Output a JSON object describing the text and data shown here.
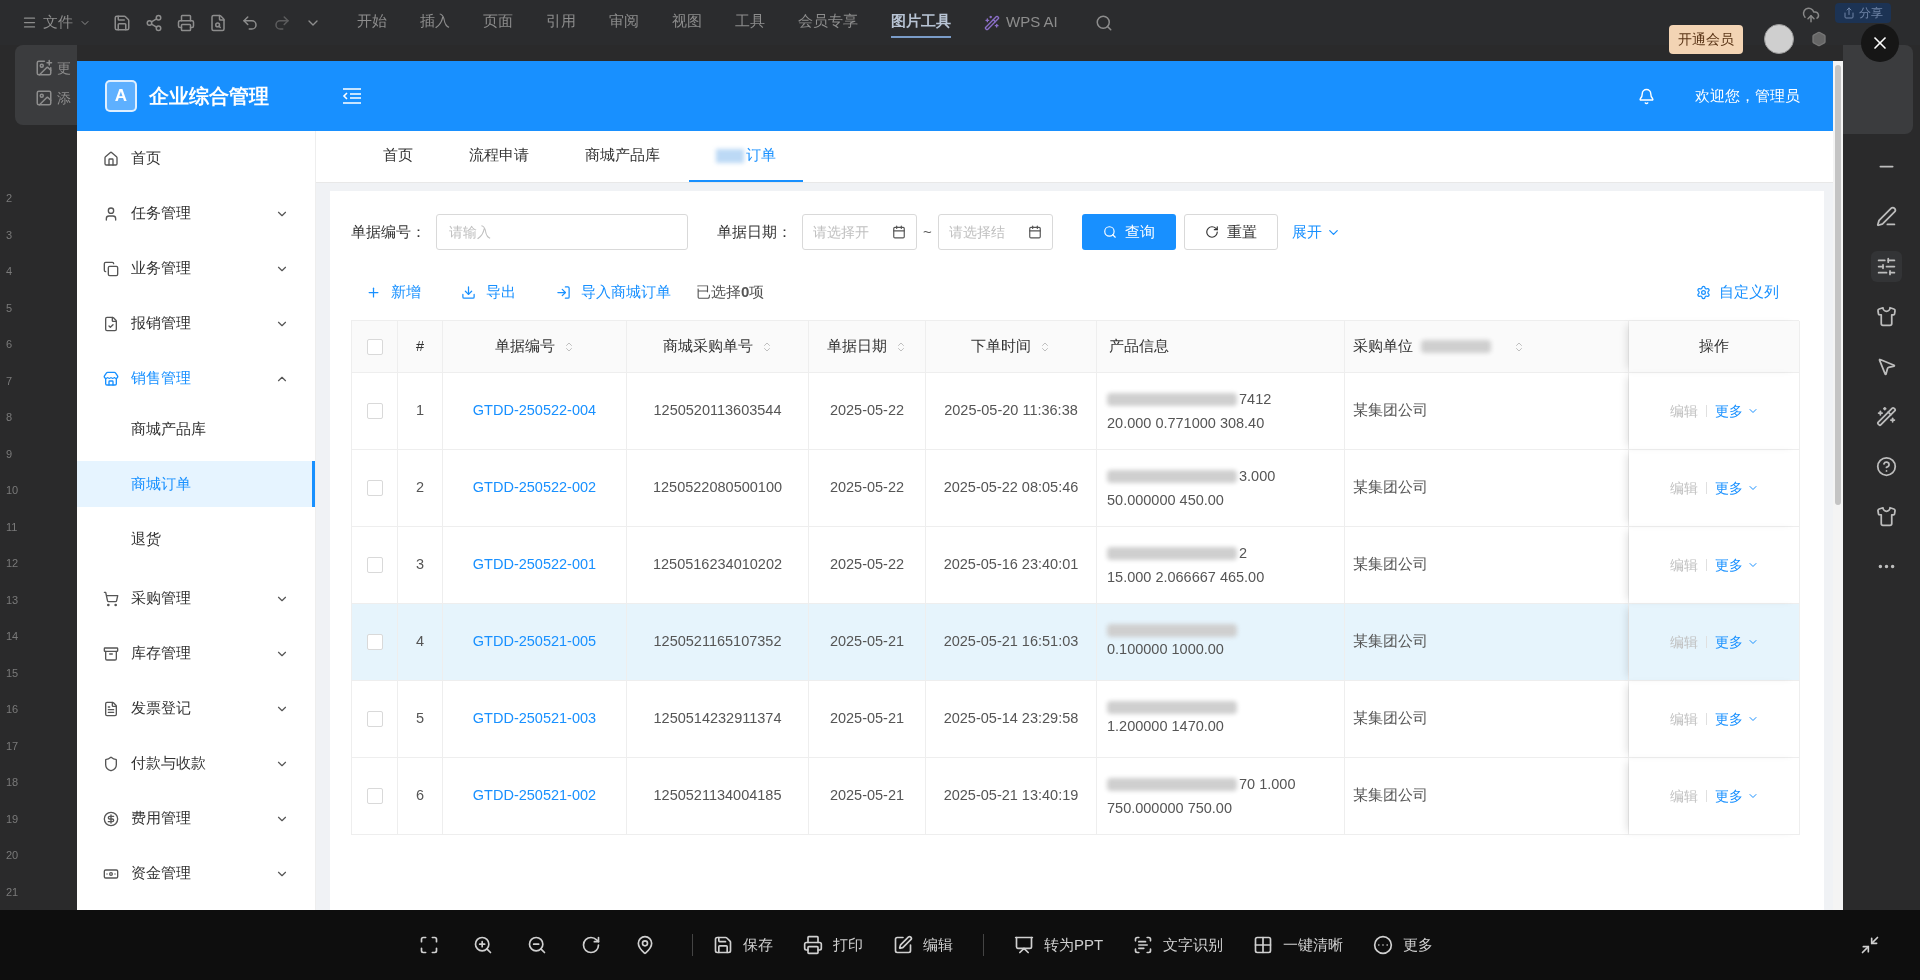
{
  "editor": {
    "menu_label": "文件",
    "ribbon_tabs": [
      {
        "label": "开始",
        "selected": false
      },
      {
        "label": "插入",
        "selected": false
      },
      {
        "label": "页面",
        "selected": false
      },
      {
        "label": "引用",
        "selected": false
      },
      {
        "label": "审阅",
        "selected": false
      },
      {
        "label": "视图",
        "selected": false
      },
      {
        "label": "工具",
        "selected": false
      },
      {
        "label": "会员专享",
        "selected": false
      },
      {
        "label": "图片工具",
        "selected": true
      }
    ],
    "ai_label": "WPS AI",
    "share_label": "分享",
    "member_label": "开通会员",
    "panel_fragments": [
      "更",
      "添"
    ],
    "ruler_marks": [
      "2",
      "3",
      "4",
      "5",
      "6",
      "7",
      "8",
      "9",
      "10",
      "11",
      "12",
      "13",
      "14",
      "15",
      "16",
      "17",
      "18",
      "19",
      "20",
      "21"
    ]
  },
  "app": {
    "logo_letter": "A",
    "title": "企业综合管理",
    "welcome": "欢迎您，管理员",
    "sidebar": [
      {
        "label": "首页",
        "kind": "link"
      },
      {
        "label": "任务管理",
        "kind": "group",
        "expanded": false
      },
      {
        "label": "业务管理",
        "kind": "group",
        "expanded": false
      },
      {
        "label": "报销管理",
        "kind": "group",
        "expanded": false
      },
      {
        "label": "销售管理",
        "kind": "group",
        "expanded": true,
        "children": [
          {
            "label": "商城产品库",
            "selected": false
          },
          {
            "label": "商城订单",
            "selected": true
          },
          {
            "label": "退货",
            "selected": false
          }
        ]
      },
      {
        "label": "采购管理",
        "kind": "group",
        "expanded": false
      },
      {
        "label": "库存管理",
        "kind": "group",
        "expanded": false
      },
      {
        "label": "发票登记",
        "kind": "group",
        "expanded": false
      },
      {
        "label": "付款与收款",
        "kind": "group",
        "expanded": false
      },
      {
        "label": "费用管理",
        "kind": "group",
        "expanded": false
      },
      {
        "label": "资金管理",
        "kind": "group",
        "expanded": false
      }
    ],
    "tabs": [
      {
        "label": "首页",
        "selected": false,
        "redacted": false
      },
      {
        "label": "流程申请",
        "selected": false,
        "redacted": false
      },
      {
        "label": "商城产品库",
        "selected": false,
        "redacted": false
      },
      {
        "label": "订单",
        "selected": true,
        "redacted": true
      }
    ],
    "filters": {
      "code_label": "单据编号：",
      "code_placeholder": "请输入",
      "date_label": "单据日期：",
      "start_placeholder": "请选择开",
      "end_placeholder": "请选择结",
      "separator": "~",
      "query_label": "查询",
      "reset_label": "重置",
      "expand_label": "展开"
    },
    "toolbar": {
      "actions": [
        "新增",
        "导出",
        "导入商城订单"
      ],
      "selection": "已选择**0**项",
      "columns_label": "自定义列"
    },
    "table": {
      "select_all_checked": false,
      "columns": [
        {
          "label": "#",
          "sortable": false,
          "redacted": false
        },
        {
          "label": "单据编号",
          "sortable": true,
          "redacted": false
        },
        {
          "label": "商城采购单号",
          "sortable": true,
          "redacted": false
        },
        {
          "label": "单据日期",
          "sortable": true,
          "redacted": false
        },
        {
          "label": "下单时间",
          "sortable": true,
          "redacted": false
        },
        {
          "label": "产品信息",
          "sortable": false,
          "redacted": false
        },
        {
          "label": "采购单位",
          "sortable": true,
          "redacted": true
        },
        {
          "label": "操作",
          "sortable": false,
          "redacted": false
        }
      ],
      "rows": [
        {
          "index": "1",
          "code": "GTDD-250522-004",
          "purchase_no": "1250520113603544",
          "date": "2025-05-22",
          "order_time": "2025-05-20 11:36:38",
          "product_tail": "7412",
          "product_line2": "20.000 0.771000 308.40",
          "buyer": "某集团公司",
          "edit": "编辑",
          "more": "更多",
          "checked": false,
          "selected": false
        },
        {
          "index": "2",
          "code": "GTDD-250522-002",
          "purchase_no": "1250522080500100",
          "date": "2025-05-22",
          "order_time": "2025-05-22 08:05:46",
          "product_tail": "3.000",
          "product_line2": "50.000000 450.00",
          "buyer": "某集团公司",
          "edit": "编辑",
          "more": "更多",
          "checked": false,
          "selected": false
        },
        {
          "index": "3",
          "code": "GTDD-250522-001",
          "purchase_no": "1250516234010202",
          "date": "2025-05-22",
          "order_time": "2025-05-16 23:40:01",
          "product_tail": "2",
          "product_line2": "15.000 2.066667 465.00",
          "buyer": "某集团公司",
          "edit": "编辑",
          "more": "更多",
          "checked": false,
          "selected": false
        },
        {
          "index": "4",
          "code": "GTDD-250521-005",
          "purchase_no": "1250521165107352",
          "date": "2025-05-21",
          "order_time": "2025-05-21 16:51:03",
          "product_line2": "0.100000 1000.00",
          "buyer": "某集团公司",
          "edit": "编辑",
          "more": "更多",
          "checked": false,
          "selected": true
        },
        {
          "index": "5",
          "code": "GTDD-250521-003",
          "purchase_no": "1250514232911374",
          "date": "2025-05-21",
          "order_time": "2025-05-14 23:29:58",
          "product_line2": "1.200000 1470.00",
          "buyer": "某集团公司",
          "edit": "编辑",
          "more": "更多",
          "checked": false,
          "selected": false
        },
        {
          "index": "6",
          "code": "GTDD-250521-002",
          "purchase_no": "1250521134004185",
          "date": "2025-05-21",
          "order_time": "2025-05-21 13:40:19",
          "product_tail": "70 1.000",
          "product_line2": "750.000000 750.00",
          "buyer": "某集团公司",
          "edit": "编辑",
          "more": "更多",
          "checked": false,
          "selected": false
        }
      ]
    }
  },
  "viewer": {
    "actions": [
      "保存",
      "打印",
      "编辑",
      "转为PPT",
      "文字识别",
      "一键清晰",
      "更多"
    ]
  }
}
